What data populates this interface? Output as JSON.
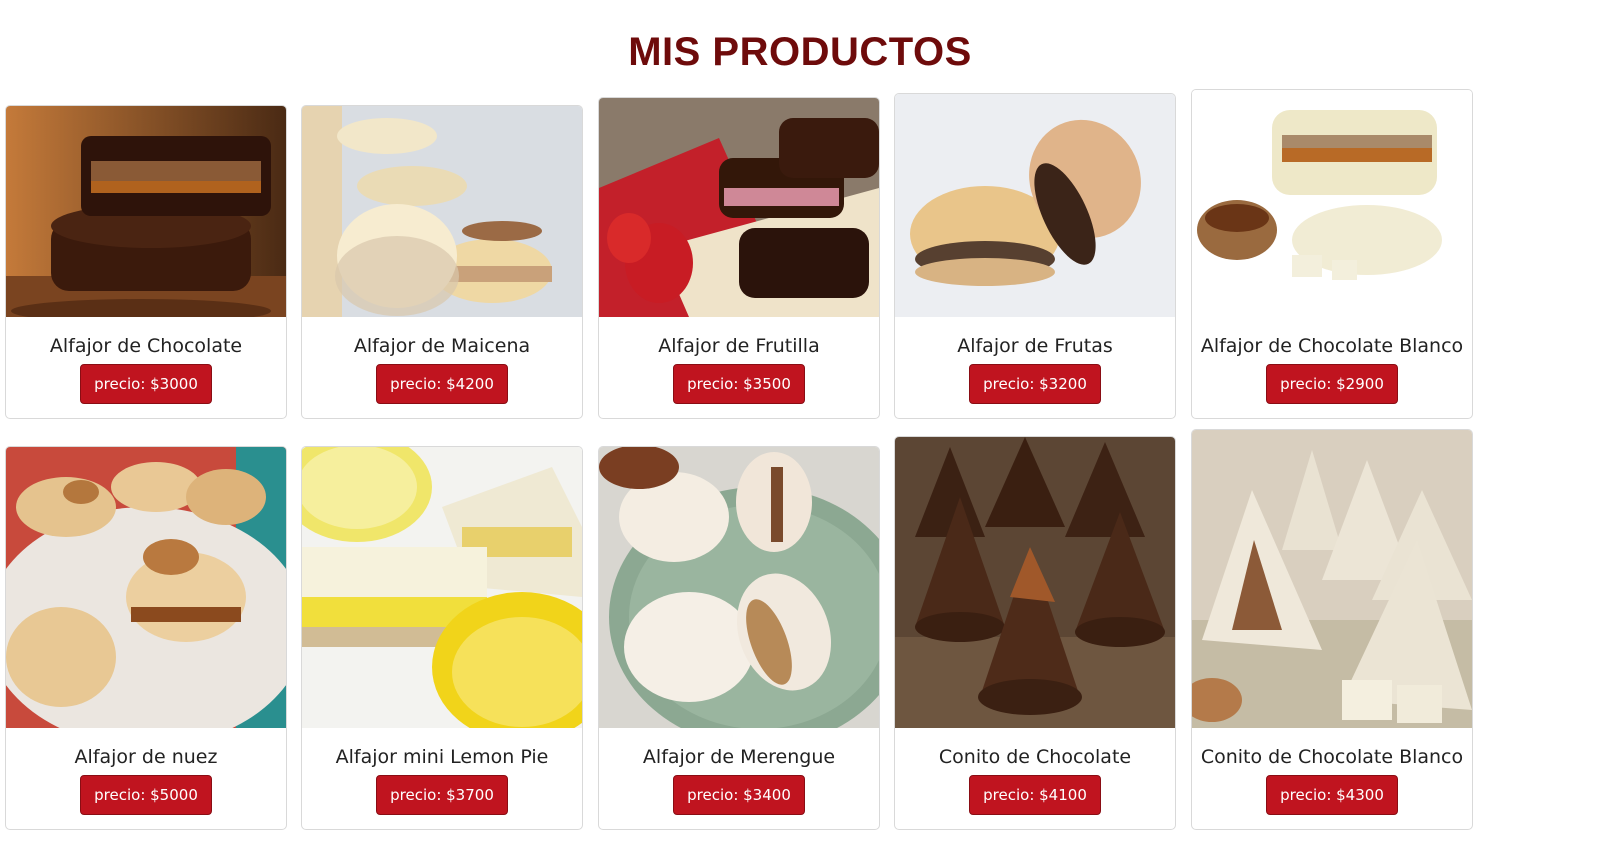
{
  "page": {
    "title": "MIS PRODUCTOS"
  },
  "products": [
    {
      "name": "Alfajor de Chocolate",
      "price": "precio: $3000"
    },
    {
      "name": "Alfajor de Maicena",
      "price": "precio: $4200"
    },
    {
      "name": "Alfajor de Frutilla",
      "price": "precio: $3500"
    },
    {
      "name": "Alfajor de Frutas",
      "price": "precio: $3200"
    },
    {
      "name": "Alfajor de Chocolate Blanco",
      "price": "precio: $2900"
    },
    {
      "name": "Alfajor de nuez",
      "price": "precio: $5000"
    },
    {
      "name": "Alfajor mini Lemon Pie",
      "price": "precio: $3700"
    },
    {
      "name": "Alfajor de Merengue",
      "price": "precio: $3400"
    },
    {
      "name": "Conito de Chocolate",
      "price": "precio: $4100"
    },
    {
      "name": "Conito de Chocolate Blanco",
      "price": "precio: $4300"
    }
  ],
  "colors": {
    "title": "#6e0b0b",
    "button": "#c0141f",
    "card_border": "#d9d9d9"
  }
}
